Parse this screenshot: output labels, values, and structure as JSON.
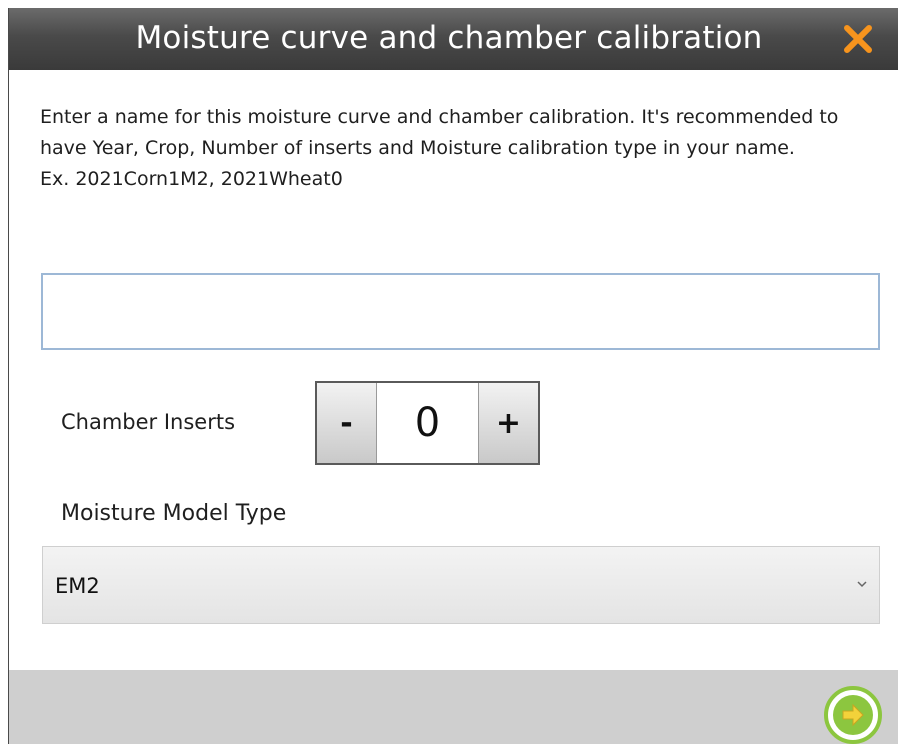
{
  "dialog": {
    "title": "Moisture curve and chamber calibration"
  },
  "instructions": {
    "line1": "Enter a name for this moisture curve and chamber calibration. It's recommended to have Year, Crop, Number of inserts and Moisture calibration type in your name.",
    "line2": "Ex. 2021Corn1M2, 2021Wheat0"
  },
  "name_input": {
    "value": "",
    "placeholder": ""
  },
  "chamber_inserts": {
    "label": "Chamber Inserts",
    "minus_label": "-",
    "plus_label": "+",
    "value": "0"
  },
  "moisture_model": {
    "label": "Moisture Model Type",
    "selected": "EM2"
  },
  "icons": {
    "close": "close-icon",
    "next": "arrow-right-icon",
    "dropdown": "chevron-down-icon"
  },
  "colors": {
    "close_accent": "#f7941d",
    "next_ring": "#8cc63f",
    "next_arrow": "#f3d23a"
  }
}
